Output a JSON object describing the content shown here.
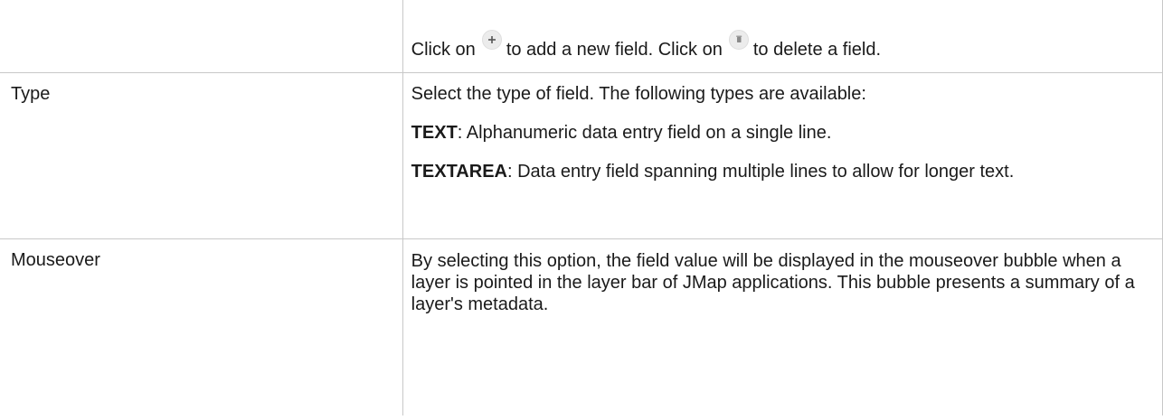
{
  "rows": [
    {
      "label": "",
      "text_before_add": "Click on",
      "text_after_add": "to add a new field. Click on",
      "text_after_delete": "to delete a field.",
      "add_icon": "plus-icon",
      "delete_icon": "trash-icon"
    },
    {
      "label": "Type",
      "intro": "Select the type of field. The following types are available:",
      "options": [
        {
          "term": "TEXT",
          "desc": ": Alphanumeric data entry field on a single line."
        },
        {
          "term": "TEXTAREA",
          "desc": ": Data entry field spanning multiple lines to allow for longer text."
        }
      ]
    },
    {
      "label": "Mouseover",
      "desc": "By selecting this option, the field value will be displayed in the mouseover bubble when a layer is pointed in the layer bar of JMap applications. This bubble presents a summary of a layer's metadata."
    }
  ],
  "colors": {
    "border": "#c8c8c8",
    "text": "#1a1a1a",
    "icon_bg": "#ececec",
    "icon_glyph": "#555555"
  }
}
